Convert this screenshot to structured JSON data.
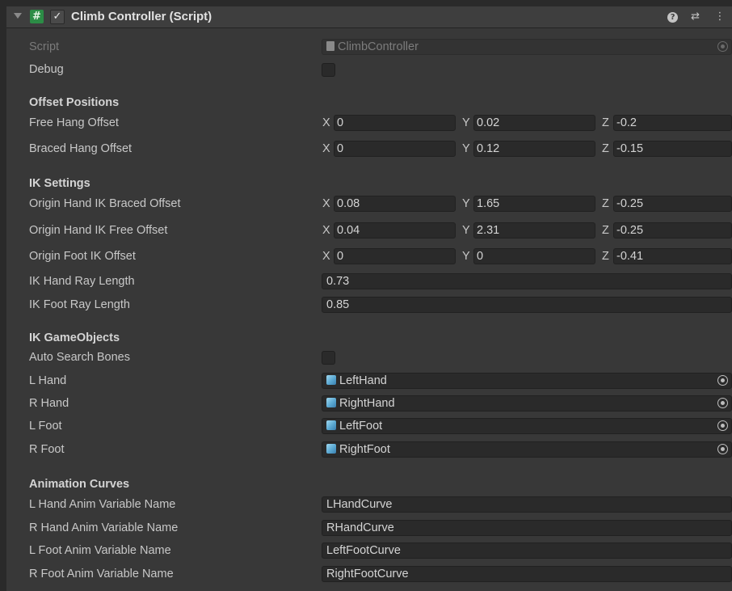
{
  "header": {
    "title": "Climb Controller (Script)",
    "script_icon_glyph": "#",
    "enabled_glyph": "✓",
    "help_glyph": "?",
    "presets_glyph": "⇄",
    "menu_glyph": "⋮"
  },
  "script": {
    "label": "Script",
    "value": "ClimbController"
  },
  "debug": {
    "label": "Debug",
    "checked": false
  },
  "offset_positions": {
    "title": "Offset Positions",
    "rows": [
      {
        "label": "Free Hang Offset",
        "x": "0",
        "y": "0.02",
        "z": "-0.2"
      },
      {
        "label": "Braced Hang Offset",
        "x": "0",
        "y": "0.12",
        "z": "-0.15"
      }
    ]
  },
  "ik_settings": {
    "title": "IK Settings",
    "vectors": [
      {
        "label": "Origin Hand IK Braced Offset",
        "x": "0.08",
        "y": "1.65",
        "z": "-0.25"
      },
      {
        "label": "Origin Hand IK Free Offset",
        "x": "0.04",
        "y": "2.31",
        "z": "-0.25"
      },
      {
        "label": "Origin Foot IK Offset",
        "x": "0",
        "y": "0",
        "z": "-0.41"
      }
    ],
    "floats": [
      {
        "label": "IK Hand Ray Length",
        "value": "0.73"
      },
      {
        "label": "IK Foot Ray Length",
        "value": "0.85"
      }
    ]
  },
  "ik_gameobjects": {
    "title": "IK GameObjects",
    "auto_search": {
      "label": "Auto Search Bones",
      "checked": false
    },
    "objects": [
      {
        "label": "L Hand",
        "value": "LeftHand"
      },
      {
        "label": "R Hand",
        "value": "RightHand"
      },
      {
        "label": "L Foot",
        "value": "LeftFoot"
      },
      {
        "label": "R Foot",
        "value": "RightFoot"
      }
    ]
  },
  "animation_curves": {
    "title": "Animation Curves",
    "rows": [
      {
        "label": "L Hand Anim Variable Name",
        "value": "LHandCurve"
      },
      {
        "label": "R Hand Anim Variable Name",
        "value": "RHandCurve"
      },
      {
        "label": "L Foot Anim Variable Name",
        "value": "LeftFootCurve"
      },
      {
        "label": "R Foot Anim Variable Name",
        "value": "RightFootCurve"
      }
    ]
  },
  "axis_labels": {
    "x": "X",
    "y": "Y",
    "z": "Z"
  }
}
